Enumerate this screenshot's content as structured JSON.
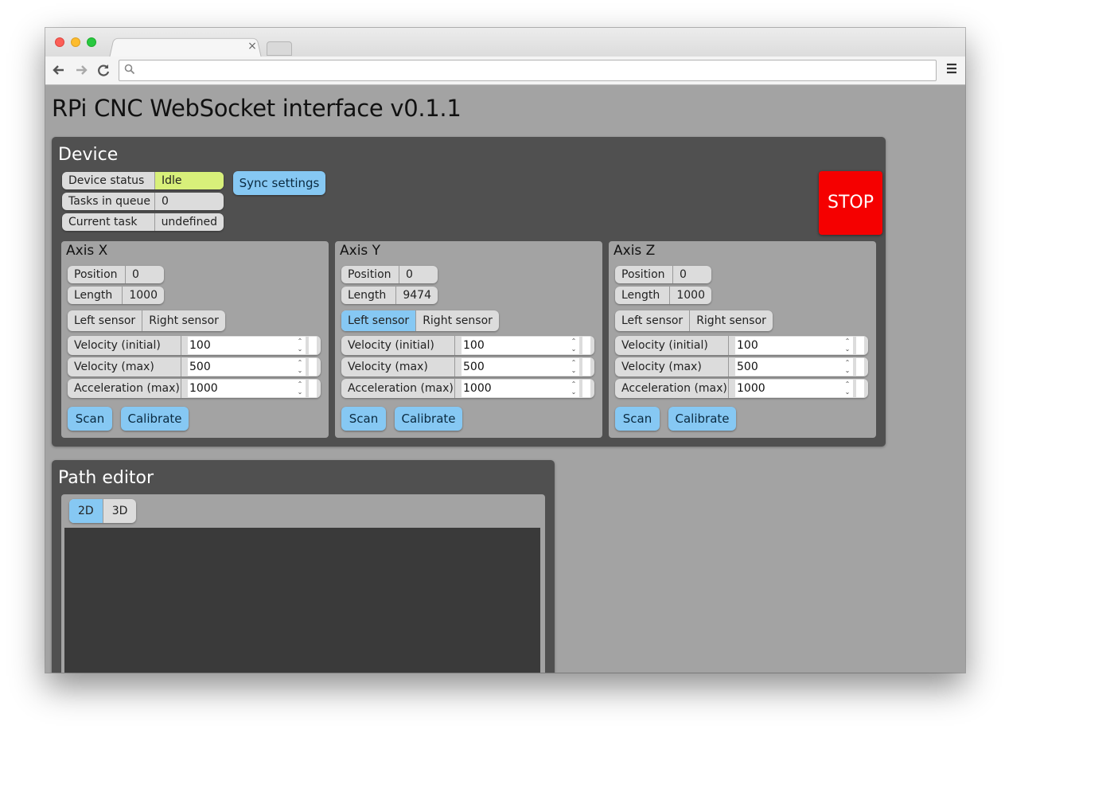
{
  "browser": {
    "tab_close": "×",
    "icons": {
      "back": "back-arrow-icon",
      "forward": "forward-arrow-icon",
      "reload": "reload-icon",
      "search": "search-icon",
      "menu": "hamburger-menu-icon"
    }
  },
  "page_title": "RPi CNC WebSocket interface v0.1.1",
  "device": {
    "title": "Device",
    "status_rows": [
      {
        "label": "Device status",
        "value": "Idle",
        "value_color": "#d8f07a"
      },
      {
        "label": "Tasks in queue",
        "value": "0"
      },
      {
        "label": "Current task",
        "value": "undefined"
      }
    ],
    "sync_label": "Sync settings",
    "stop_label": "STOP",
    "stop_color": "#f50000"
  },
  "axes": [
    {
      "title": "Axis X",
      "position_label": "Position",
      "position": "0",
      "length_label": "Length",
      "length": "1000",
      "left_sensor": "Left sensor",
      "right_sensor": "Right sensor",
      "left_active": false,
      "fields": [
        {
          "label": "Velocity (initial)",
          "value": "100"
        },
        {
          "label": "Velocity (max)",
          "value": "500"
        },
        {
          "label": "Acceleration (max)",
          "value": "1000"
        }
      ],
      "scan_label": "Scan",
      "calibrate_label": "Calibrate"
    },
    {
      "title": "Axis Y",
      "position_label": "Position",
      "position": "0",
      "length_label": "Length",
      "length": "9474",
      "left_sensor": "Left sensor",
      "right_sensor": "Right sensor",
      "left_active": true,
      "fields": [
        {
          "label": "Velocity (initial)",
          "value": "100"
        },
        {
          "label": "Velocity (max)",
          "value": "500"
        },
        {
          "label": "Acceleration (max)",
          "value": "1000"
        }
      ],
      "scan_label": "Scan",
      "calibrate_label": "Calibrate"
    },
    {
      "title": "Axis Z",
      "position_label": "Position",
      "position": "0",
      "length_label": "Length",
      "length": "1000",
      "left_sensor": "Left sensor",
      "right_sensor": "Right sensor",
      "left_active": false,
      "fields": [
        {
          "label": "Velocity (initial)",
          "value": "100"
        },
        {
          "label": "Velocity (max)",
          "value": "500"
        },
        {
          "label": "Acceleration (max)",
          "value": "1000"
        }
      ],
      "scan_label": "Scan",
      "calibrate_label": "Calibrate"
    }
  ],
  "path_editor": {
    "title": "Path editor",
    "tabs": [
      {
        "label": "2D",
        "active": true
      },
      {
        "label": "3D",
        "active": false
      }
    ]
  },
  "colors": {
    "accent": "#86c8f3",
    "panel": "#505050",
    "page_bg": "#a3a3a3"
  }
}
